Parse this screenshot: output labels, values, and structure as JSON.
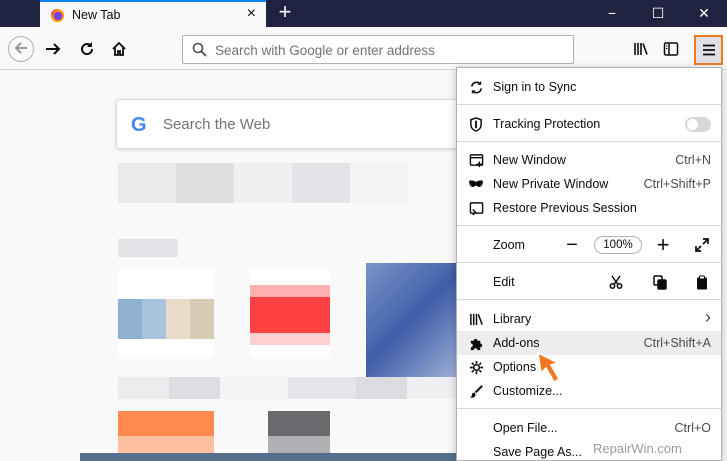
{
  "browser": {
    "tab": {
      "title": "New Tab",
      "close": "×"
    },
    "new_tab": "+",
    "window_controls": {
      "minimize": "−",
      "maximize": "☐",
      "close": "✕"
    },
    "urlbar": {
      "placeholder": "Search with Google or enter address"
    }
  },
  "newtab_page": {
    "search": {
      "logo": "G",
      "placeholder": "Search the Web"
    }
  },
  "menu": {
    "items": [
      {
        "name": "sign-in-to-sync",
        "label": "Sign in to Sync",
        "icon": "sync-icon"
      },
      {
        "name": "tracking-protection",
        "label": "Tracking Protection",
        "icon": "shield-icon"
      },
      {
        "name": "new-window",
        "label": "New Window",
        "shortcut": "Ctrl+N",
        "icon": "new-window-icon"
      },
      {
        "name": "new-private-window",
        "label": "New Private Window",
        "shortcut": "Ctrl+Shift+P",
        "icon": "mask-icon"
      },
      {
        "name": "restore-previous-session",
        "label": "Restore Previous Session",
        "icon": "restore-icon"
      },
      {
        "name": "zoom",
        "label": "Zoom",
        "value": "100%",
        "minus": "−",
        "plus": "+"
      },
      {
        "name": "edit",
        "label": "Edit"
      },
      {
        "name": "library",
        "label": "Library",
        "chevron": "›",
        "icon": "library-icon"
      },
      {
        "name": "add-ons",
        "label": "Add-ons",
        "shortcut": "Ctrl+Shift+A",
        "icon": "puzzle-icon"
      },
      {
        "name": "options",
        "label": "Options",
        "icon": "gear-icon"
      },
      {
        "name": "customize",
        "label": "Customize...",
        "icon": "paintbrush-icon"
      },
      {
        "name": "open-file",
        "label": "Open File...",
        "shortcut": "Ctrl+O"
      },
      {
        "name": "save-page-as",
        "label": "Save Page As..."
      }
    ]
  },
  "watermark": "RepairWin.com",
  "colors": {
    "tabbar": "#202340",
    "accent": "#0a84ff",
    "highlight_border": "#f07820",
    "cursor": "#f07820"
  }
}
